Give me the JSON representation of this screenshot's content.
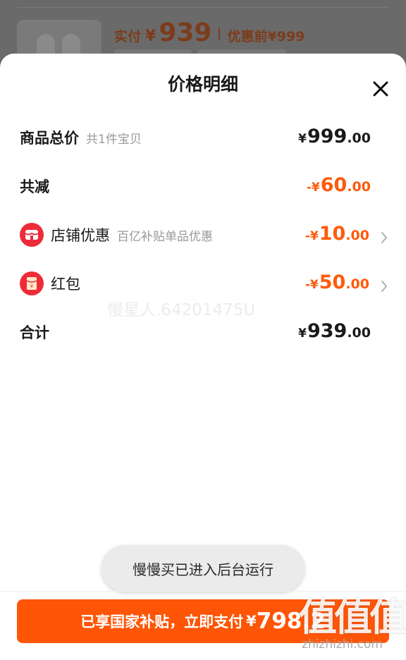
{
  "background_card": {
    "price_label": "实付",
    "currency": "¥",
    "price": "939",
    "original_label": "优惠前",
    "original_price": "¥999"
  },
  "sheet": {
    "title": "价格明细",
    "close_icon": "close-icon"
  },
  "rows": {
    "total": {
      "label": "商品总价",
      "sub": "共1件宝贝",
      "yen": "¥",
      "int": "999",
      "dec": ".00"
    },
    "discount": {
      "label": "共减",
      "prefix": "-¥",
      "int": "60",
      "dec": ".00"
    },
    "shop": {
      "icon": "shop-icon",
      "label": "店铺优惠",
      "sub": "百亿补贴单品优惠",
      "prefix": "-¥",
      "int": "10",
      "dec": ".00"
    },
    "redpacket": {
      "icon": "red-packet-icon",
      "label": "红包",
      "prefix": "-¥",
      "int": "50",
      "dec": ".00"
    },
    "sum": {
      "label": "合计",
      "yen": "¥",
      "int": "939",
      "dec": ".00"
    }
  },
  "watermark": "慢星人.64201475U",
  "toast": "慢慢买已进入后台运行",
  "pay_button": {
    "text": "已享国家补贴，立即支付",
    "yen": "¥",
    "amount": "798.2"
  },
  "site_watermark": {
    "brand": "值值值",
    "url": "zhizhizhi.com"
  },
  "colors": {
    "accent": "#ff5506",
    "discount": "#ff5a0a",
    "icon_red": "#ee2b38"
  }
}
